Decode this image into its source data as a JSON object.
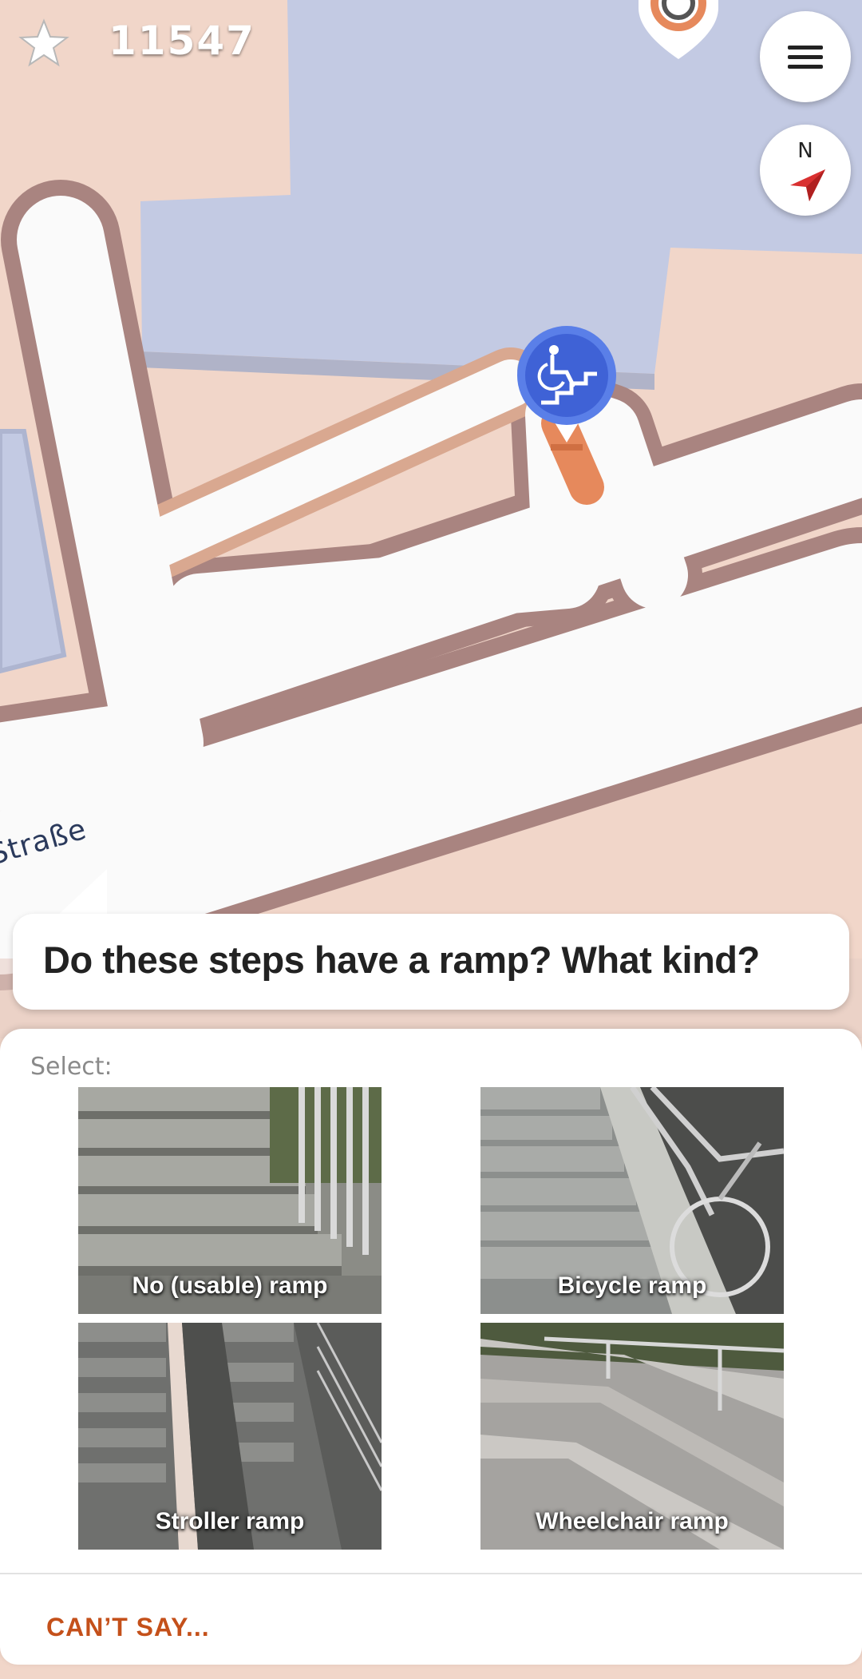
{
  "score": {
    "value": "11547"
  },
  "street": {
    "name": "Straße"
  },
  "compass": {
    "label": "N"
  },
  "quest": {
    "question": "Do these steps have a ramp? What kind?"
  },
  "sheet": {
    "select_label": "Select:",
    "options": [
      {
        "label": "No (usable) ramp"
      },
      {
        "label": "Bicycle ramp"
      },
      {
        "label": "Stroller ramp"
      },
      {
        "label": "Wheelchair ramp"
      }
    ],
    "cant_say": "CAN’T SAY..."
  },
  "colors": {
    "accent": "#c4501a",
    "marker": "#4f74e0",
    "map_land": "#f1d6c9",
    "map_building": "#c3cae3",
    "map_road": "#fafafa",
    "road_edge": "#a98480"
  },
  "icons": [
    "star-icon",
    "menu-icon",
    "compass-arrow-icon",
    "wheelchair-steps-icon"
  ]
}
